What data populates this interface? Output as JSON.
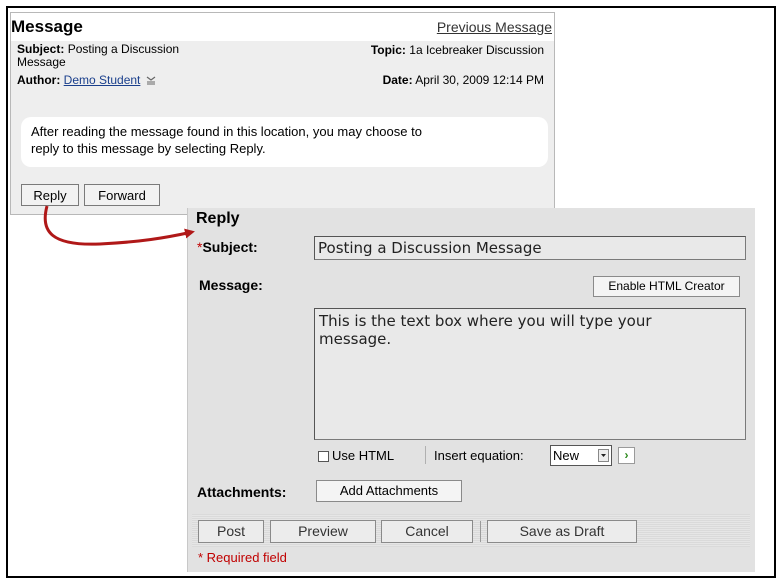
{
  "message": {
    "title": "Message",
    "previous_link": "Previous Message",
    "subject_label": "Subject:",
    "subject_value_line1": "Posting a Discussion",
    "subject_value_line2": "Message",
    "topic_label": "Topic:",
    "topic_value": "1a Icebreaker Discussion",
    "author_label": "Author:",
    "author_value": "Demo Student",
    "date_label": "Date:",
    "date_value": "April 30, 2009 12:14 PM",
    "body_line1": "After reading the message found in this location, you may choose to",
    "body_line2": "reply to this message by selecting Reply.",
    "reply_button": "Reply",
    "forward_button": "Forward"
  },
  "reply": {
    "title": "Reply",
    "required_marker": "*",
    "subject_label": "Subject:",
    "subject_value": "Posting a Discussion Message",
    "message_label": "Message:",
    "html_creator_button": "Enable HTML Creator",
    "message_line1": "This is the text box where you will type your",
    "message_line2": "message.",
    "use_html_label": "Use HTML",
    "insert_equation_label": "Insert equation:",
    "equation_select_value": "New",
    "attachments_label": "Attachments:",
    "add_attachments_button": "Add Attachments",
    "actions": {
      "post": "Post",
      "preview": "Preview",
      "cancel": "Cancel",
      "save_draft": "Save as Draft"
    },
    "required_note": "* Required field"
  },
  "colors": {
    "required": "#c00000",
    "arrow": "#b01818",
    "link": "#1a3f8c"
  }
}
